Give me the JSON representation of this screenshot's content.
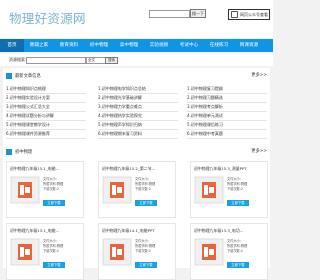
{
  "header": {
    "logo": "物理好资源网",
    "search_button": "搜一下",
    "wechat_label": "网页公众号查看"
  },
  "nav": {
    "items": [
      {
        "label": "首页",
        "active": true
      },
      {
        "label": "教辅之家",
        "active": false
      },
      {
        "label": "教育资料",
        "active": false
      },
      {
        "label": "初中物理",
        "active": false
      },
      {
        "label": "高中物理",
        "active": false
      },
      {
        "label": "实验视频",
        "active": false
      },
      {
        "label": "考试中心",
        "active": false
      },
      {
        "label": "在线练习",
        "active": false
      },
      {
        "label": "网课资源",
        "active": false
      }
    ]
  },
  "search": {
    "label": "资源搜索:",
    "select_value": "全文",
    "button": "搜索"
  },
  "recommend": {
    "title": "最新文章信息",
    "more": "更多>>",
    "col1": [
      "1.初中物理知识点梳理",
      "2.初中物理实验设计方案",
      "3.初中物理公式汇总大全",
      "4.初中物理试题分析与讲解",
      "5.初中物理课堂教学设计",
      "6.初中物理课件资源推荐"
    ],
    "col2": [
      "1.初中物理电学知识点总结",
      "2.初中物理光学基础讲解",
      "3.初中物理力学重点难点",
      "4.初中物理热学实验探究",
      "5.初中物理声学知识归纳",
      "6.初中物理期末复习资料"
    ],
    "col3": [
      "1.初中物理复习提纲",
      "2.初中物理习题精选",
      "3.初中物理考点解析",
      "4.初中物理单元测试",
      "5.初中物理课后练习",
      "6.初中物理中考真题"
    ]
  },
  "cards_section": {
    "title": "初中物理",
    "more": "更多>>",
    "cards": [
      {
        "title": "初中物理九年级15.1_电能...",
        "meta1": "文件大小:",
        "meta2": "所属学科:物理",
        "meta3": "下载次数:2",
        "button": "立即下载"
      },
      {
        "title": "初中物理九年级15.2_第二节...",
        "meta1": "文件大小:",
        "meta2": "所属学科:物理",
        "meta3": "下载次数:2",
        "button": "立即下载"
      },
      {
        "title": "初中物理九年级15.3_测量PPT",
        "meta1": "文件大小:",
        "meta2": "所属学科:物理",
        "meta3": "下载次数:2",
        "button": "立即下载"
      },
      {
        "title": "初中物理九年级13.1_电能...",
        "meta1": "文件大小:",
        "meta2": "所属学科:物理",
        "meta3": "下载次数:2",
        "button": "立即下载"
      },
      {
        "title": "初中物理九年级14.1_电能PPT",
        "meta1": "文件大小:",
        "meta2": "所属学科:物理",
        "meta3": "下载次数:2",
        "button": "立即下载"
      },
      {
        "title": "初中物理九年级13.3_电功...",
        "meta1": "文件大小:",
        "meta2": "所属学科:物理",
        "meta3": "下载次数:2",
        "button": "立即下载"
      }
    ]
  },
  "colors": {
    "nav_bg": "#0f95e6",
    "nav_active": "#0b6fb0",
    "button_blue": "#17a2e8",
    "ppt_orange": "#e8643c"
  }
}
